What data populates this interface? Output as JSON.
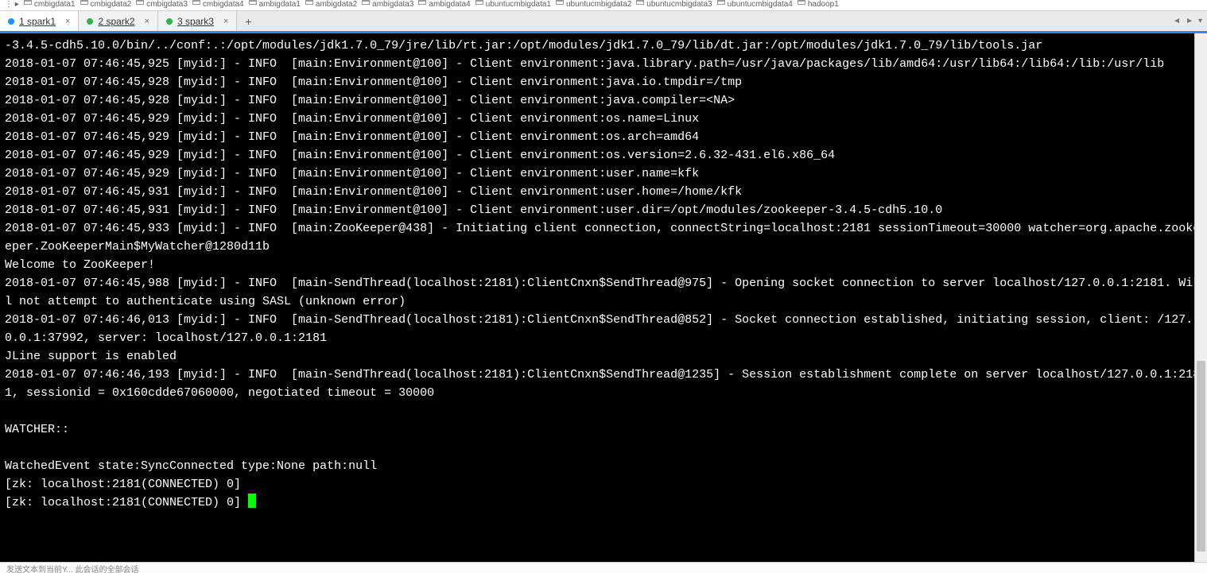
{
  "bookmarks": [
    "cmbigdata1",
    "cmbigdata2",
    "cmbigdata3",
    "cmbigdata4",
    "ambigdata1",
    "ambigdata2",
    "ambigdata3",
    "ambigdata4",
    "ubuntucmbigdata1",
    "ubuntucmbigdata2",
    "ubuntucmbigdata3",
    "ubuntucmbigdata4",
    "hadoop1"
  ],
  "tabs": [
    {
      "index": "1",
      "name": "spark1",
      "active": true,
      "dot": "blue"
    },
    {
      "index": "2",
      "name": "spark2",
      "active": false,
      "dot": "green"
    },
    {
      "index": "3",
      "name": "spark3",
      "active": false,
      "dot": "green"
    }
  ],
  "add_tab_glyph": "+",
  "overflow": {
    "left": "◄",
    "right": "►",
    "menu": "▾"
  },
  "terminal_lines": [
    "-3.4.5-cdh5.10.0/bin/../conf:.:/opt/modules/jdk1.7.0_79/jre/lib/rt.jar:/opt/modules/jdk1.7.0_79/lib/dt.jar:/opt/modules/jdk1.7.0_79/lib/tools.jar",
    "2018-01-07 07:46:45,925 [myid:] - INFO  [main:Environment@100] - Client environment:java.library.path=/usr/java/packages/lib/amd64:/usr/lib64:/lib64:/lib:/usr/lib",
    "2018-01-07 07:46:45,928 [myid:] - INFO  [main:Environment@100] - Client environment:java.io.tmpdir=/tmp",
    "2018-01-07 07:46:45,928 [myid:] - INFO  [main:Environment@100] - Client environment:java.compiler=<NA>",
    "2018-01-07 07:46:45,929 [myid:] - INFO  [main:Environment@100] - Client environment:os.name=Linux",
    "2018-01-07 07:46:45,929 [myid:] - INFO  [main:Environment@100] - Client environment:os.arch=amd64",
    "2018-01-07 07:46:45,929 [myid:] - INFO  [main:Environment@100] - Client environment:os.version=2.6.32-431.el6.x86_64",
    "2018-01-07 07:46:45,929 [myid:] - INFO  [main:Environment@100] - Client environment:user.name=kfk",
    "2018-01-07 07:46:45,931 [myid:] - INFO  [main:Environment@100] - Client environment:user.home=/home/kfk",
    "2018-01-07 07:46:45,931 [myid:] - INFO  [main:Environment@100] - Client environment:user.dir=/opt/modules/zookeeper-3.4.5-cdh5.10.0",
    "2018-01-07 07:46:45,933 [myid:] - INFO  [main:ZooKeeper@438] - Initiating client connection, connectString=localhost:2181 sessionTimeout=30000 watcher=org.apache.zookeeper.ZooKeeperMain$MyWatcher@1280d11b",
    "Welcome to ZooKeeper!",
    "2018-01-07 07:46:45,988 [myid:] - INFO  [main-SendThread(localhost:2181):ClientCnxn$SendThread@975] - Opening socket connection to server localhost/127.0.0.1:2181. Will not attempt to authenticate using SASL (unknown error)",
    "2018-01-07 07:46:46,013 [myid:] - INFO  [main-SendThread(localhost:2181):ClientCnxn$SendThread@852] - Socket connection established, initiating session, client: /127.0.0.1:37992, server: localhost/127.0.0.1:2181",
    "JLine support is enabled",
    "2018-01-07 07:46:46,193 [myid:] - INFO  [main-SendThread(localhost:2181):ClientCnxn$SendThread@1235] - Session establishment complete on server localhost/127.0.0.1:2181, sessionid = 0x160cdde67060000, negotiated timeout = 30000",
    "",
    "WATCHER::",
    "",
    "WatchedEvent state:SyncConnected type:None path:null",
    "[zk: localhost:2181(CONNECTED) 0]"
  ],
  "prompt_line": "[zk: localhost:2181(CONNECTED) 0] ",
  "status_text": "发送文本到当前Y...  此会话的全部会话"
}
